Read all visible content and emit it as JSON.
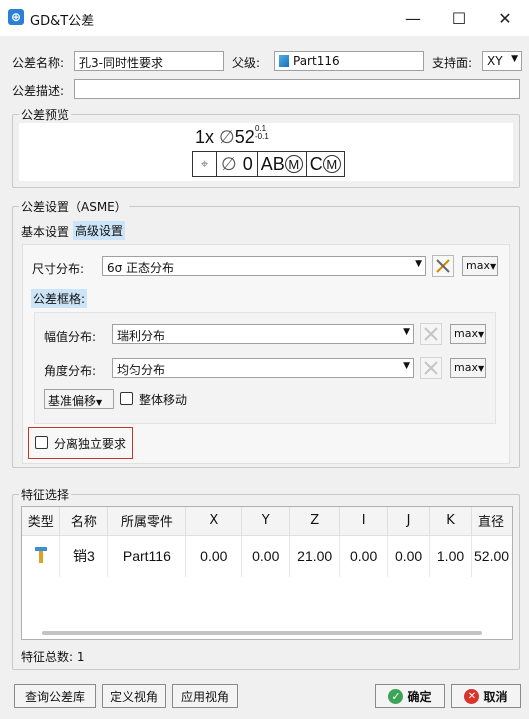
{
  "window": {
    "title": "GD&T公差",
    "minimize": "—",
    "maximize": "☐",
    "close": "✕"
  },
  "header": {
    "name_label": "公差名称:",
    "name_value": "孔3-同时性要求",
    "parent_label": "父级:",
    "parent_value": "Part116",
    "support_label": "支持面:",
    "support_value": "XY",
    "desc_label": "公差描述:",
    "desc_value": ""
  },
  "preview": {
    "title": "公差预览",
    "prefix": "1x",
    "diameter_symbol": "∅",
    "nominal": "52",
    "upper_tol": "0.1",
    "lower_tol": "-0.1",
    "frame_symbol": "⌖",
    "frame_diameter": "∅",
    "frame_value": "0",
    "frame_datum1": "A",
    "frame_datum2": "B",
    "frame_datum3": "M",
    "frame_cm1": "C",
    "frame_cm2": "M"
  },
  "settings": {
    "title": "公差设置（ASME）",
    "tab_basic": "基本设置",
    "tab_advanced": "高级设置",
    "size_dist_label": "尺寸分布:",
    "size_dist_value": "6σ 正态分布",
    "size_dist_mode": "max",
    "frame_label": "公差框格:",
    "amp_label": "幅值分布:",
    "amp_value": "瑞利分布",
    "amp_mode": "max",
    "angle_label": "角度分布:",
    "angle_value": "均匀分布",
    "angle_mode": "max",
    "datum_offset": "基准偏移",
    "move_whole": "整体移动",
    "separate_req": "分离独立要求"
  },
  "features": {
    "title": "特征选择",
    "columns": [
      "类型",
      "名称",
      "所属零件",
      "X",
      "Y",
      "Z",
      "I",
      "J",
      "K",
      "直径"
    ],
    "rows": [
      {
        "name": "销3",
        "part": "Part116",
        "x": "0.00",
        "y": "0.00",
        "z": "21.00",
        "i": "0.00",
        "j": "0.00",
        "k": "1.00",
        "d": "52.00"
      }
    ],
    "count_label": "特征总数: 1"
  },
  "footer": {
    "query": "查询公差库",
    "define_view": "定义视角",
    "apply_view": "应用视角",
    "ok": "确定",
    "cancel": "取消"
  },
  "colors": {
    "accent": "#2a7fd6",
    "highlight": "#cce4f7",
    "red_outline": "#c0392b"
  }
}
